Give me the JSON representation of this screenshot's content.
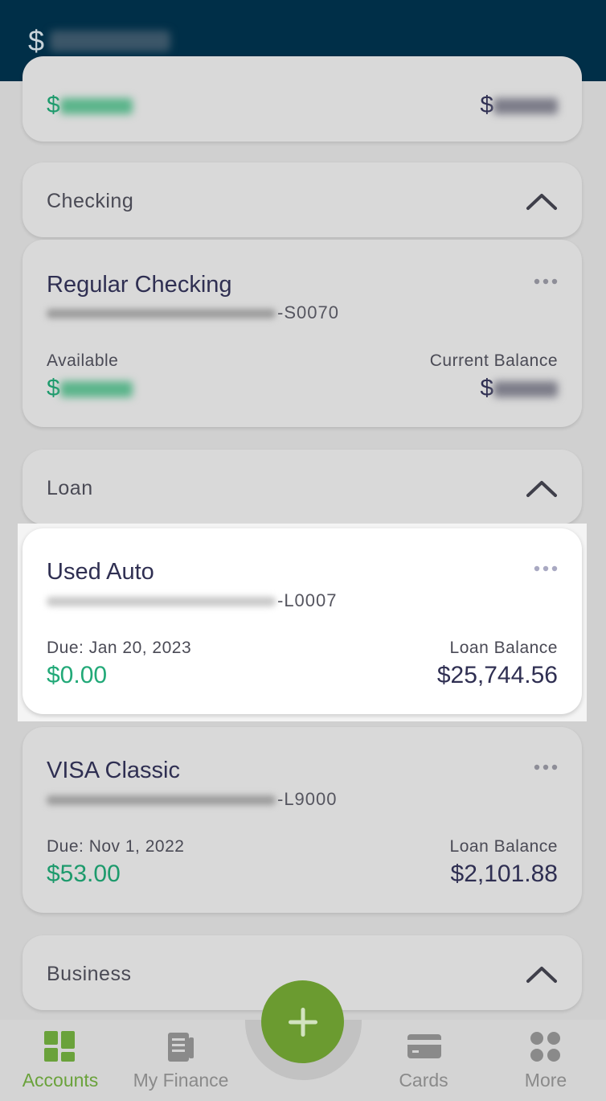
{
  "header": {
    "currency": "$"
  },
  "summary_card": {
    "currency_left": "$",
    "currency_right": "$"
  },
  "sections": {
    "checking": {
      "title": "Checking"
    },
    "loan": {
      "title": "Loan"
    },
    "business": {
      "title": "Business"
    }
  },
  "accounts": {
    "regular_checking": {
      "name": "Regular Checking",
      "number_suffix": "-S0070",
      "available_label": "Available",
      "current_label": "Current Balance",
      "currency_left": "$",
      "currency_right": "$"
    },
    "used_auto": {
      "name": "Used Auto",
      "number_suffix": "-L0007",
      "due_label": "Due: Jan 20, 2023",
      "due_amount": "$0.00",
      "balance_label": "Loan Balance",
      "balance_amount": "$25,744.56"
    },
    "visa_classic": {
      "name": "VISA Classic",
      "number_suffix": "-L9000",
      "due_label": "Due: Nov 1, 2022",
      "due_amount": "$53.00",
      "balance_label": "Loan Balance",
      "balance_amount": "$2,101.88"
    }
  },
  "tabbar": {
    "tabs": [
      {
        "label": "Accounts",
        "icon": "accounts-grid-icon",
        "active": true
      },
      {
        "label": "My Finance",
        "icon": "finance-document-icon",
        "active": false
      },
      {
        "label": "Cards",
        "icon": "card-icon",
        "active": false
      },
      {
        "label": "More",
        "icon": "more-dots-icon",
        "active": false
      }
    ],
    "fab_icon": "plus-icon"
  },
  "colors": {
    "header_bg": "#002f48",
    "green_amount": "#1d9a6c",
    "active_tab": "#6aa23b",
    "fab_bg": "#6b9b30"
  }
}
